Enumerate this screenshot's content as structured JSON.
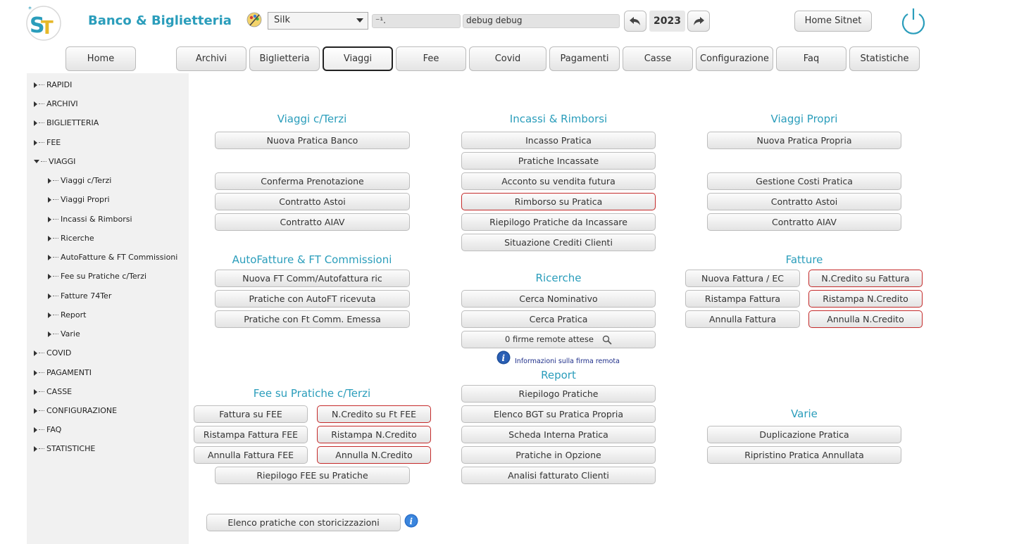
{
  "header": {
    "app_title": "Banco & Biglietteria",
    "theme_select": {
      "value": "Silk"
    },
    "agency_field": "⁻¹.",
    "user_field": "debug debug",
    "year": "2023",
    "home_sitnet": "Home Sitnet"
  },
  "tabs": [
    {
      "label": "Home"
    },
    {
      "label": "Archivi"
    },
    {
      "label": "Biglietteria"
    },
    {
      "label": "Viaggi",
      "active": true
    },
    {
      "label": "Fee"
    },
    {
      "label": "Covid"
    },
    {
      "label": "Pagamenti"
    },
    {
      "label": "Casse"
    },
    {
      "label": "Configurazione"
    },
    {
      "label": "Faq"
    },
    {
      "label": "Statistiche"
    }
  ],
  "sidebar": {
    "items": [
      {
        "label": "RAPIDI"
      },
      {
        "label": "ARCHIVI"
      },
      {
        "label": "BIGLIETTERIA"
      },
      {
        "label": "FEE"
      },
      {
        "label": "VIAGGI",
        "expanded": true
      },
      {
        "label": "Viaggi c/Terzi"
      },
      {
        "label": "Viaggi Propri"
      },
      {
        "label": "Incassi & Rimborsi"
      },
      {
        "label": "Ricerche"
      },
      {
        "label": "AutoFatture & FT Commissioni"
      },
      {
        "label": "Fee su Pratiche c/Terzi"
      },
      {
        "label": "Fatture 74Ter"
      },
      {
        "label": "Report"
      },
      {
        "label": "Varie"
      },
      {
        "label": "COVID"
      },
      {
        "label": "PAGAMENTI"
      },
      {
        "label": "CASSE"
      },
      {
        "label": "CONFIGURAZIONE"
      },
      {
        "label": "FAQ"
      },
      {
        "label": "STATISTICHE"
      }
    ]
  },
  "sections": {
    "viaggi_terzi": {
      "title": "Viaggi c/Terzi",
      "buttons": [
        "Nuova Pratica Banco",
        "Conferma Prenotazione",
        "Contratto Astoi",
        "Contratto AIAV"
      ]
    },
    "incassi_rimborsi": {
      "title": "Incassi & Rimborsi",
      "buttons": [
        "Incasso Pratica",
        "Pratiche Incassate",
        "Acconto su vendita futura",
        "Rimborso su Pratica",
        "Riepilogo Pratiche da Incassare",
        "Situazione Crediti Clienti"
      ]
    },
    "viaggi_propri": {
      "title": "Viaggi Propri",
      "buttons": [
        "Nuova Pratica Propria",
        "Gestione Costi Pratica",
        "Contratto Astoi",
        "Contratto AIAV"
      ]
    },
    "autofatture": {
      "title": "AutoFatture & FT Commissioni",
      "buttons": [
        "Nuova FT Comm/Autofattura ric",
        "Pratiche con AutoFT ricevuta",
        "Pratiche con Ft Comm. Emessa"
      ]
    },
    "ricerche": {
      "title": "Ricerche",
      "buttons": [
        "Cerca Nominativo",
        "Cerca Pratica",
        "0 firme remote attese"
      ],
      "info_link": "Informazioni sulla firma remota"
    },
    "fatture": {
      "title": "Fatture",
      "buttons": [
        "Nuova Fattura / EC",
        "N.Credito su Fattura",
        "Ristampa Fattura",
        "Ristampa N.Credito",
        "Annulla Fattura",
        "Annulla N.Credito"
      ]
    },
    "report": {
      "title": "Report",
      "buttons": [
        "Riepilogo Pratiche",
        "Elenco BGT su Pratica Propria",
        "Scheda Interna Pratica",
        "Pratiche in Opzione",
        "Analisi fatturato Clienti"
      ]
    },
    "fee_terzi": {
      "title": "Fee su Pratiche c/Terzi",
      "buttons": [
        "Fattura su FEE",
        "N.Credito su Ft FEE",
        "Ristampa Fattura FEE",
        "Ristampa N.Credito",
        "Annulla Fattura FEE",
        "Annulla N.Credito",
        "Riepilogo FEE su Pratiche"
      ]
    },
    "varie": {
      "title": "Varie",
      "buttons": [
        "Duplicazione Pratica",
        "Ripristino Pratica Annullata"
      ]
    },
    "storicizzazioni": {
      "button": "Elenco pratiche con storicizzazioni"
    }
  },
  "colors": {
    "accent": "#2a9dbb",
    "danger_border": "#c42a2a",
    "link": "#1f2f8a",
    "sidebar_bg": "#f1f1f1"
  },
  "icons": [
    "logo-icon",
    "palette-icon",
    "arrow-left-icon",
    "arrow-right-icon",
    "power-icon",
    "info-icon",
    "magnifier-icon"
  ]
}
